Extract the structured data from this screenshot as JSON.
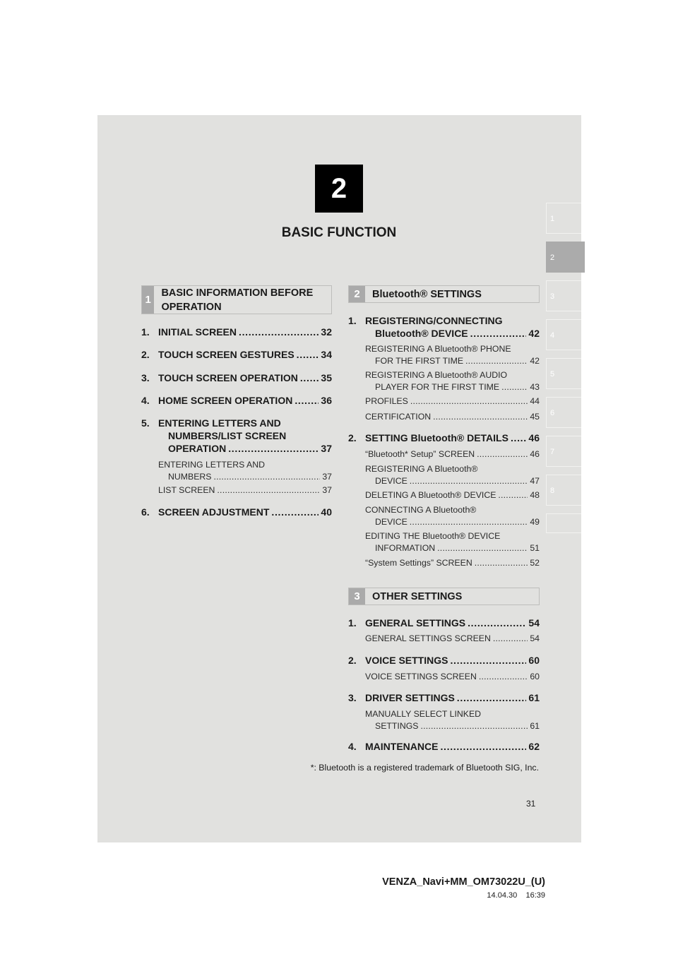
{
  "chapter": {
    "number": "2",
    "title": "BASIC FUNCTION"
  },
  "side_tabs": [
    {
      "label": "1"
    },
    {
      "label": "2",
      "active": true
    },
    {
      "label": "3"
    },
    {
      "label": "4"
    },
    {
      "label": "5"
    },
    {
      "label": "6"
    },
    {
      "label": "7"
    },
    {
      "label": "8"
    },
    {
      "label": ""
    }
  ],
  "sections": [
    {
      "num": "1",
      "title": "BASIC INFORMATION BEFORE OPERATION",
      "entries": [
        {
          "level": "main",
          "num": "1.",
          "lines": [
            "INITIAL SCREEN"
          ],
          "page": "32"
        },
        {
          "level": "main",
          "num": "2.",
          "lines": [
            "TOUCH SCREEN GESTURES"
          ],
          "page": "34"
        },
        {
          "level": "main",
          "num": "3.",
          "lines": [
            "TOUCH SCREEN OPERATION"
          ],
          "page": "35"
        },
        {
          "level": "main",
          "num": "4.",
          "lines": [
            "HOME SCREEN OPERATION"
          ],
          "page": "36"
        },
        {
          "level": "main",
          "num": "5.",
          "lines": [
            "ENTERING LETTERS AND",
            "NUMBERS/LIST SCREEN",
            "OPERATION"
          ],
          "page": "37"
        },
        {
          "level": "sub",
          "lines": [
            "ENTERING LETTERS AND",
            "NUMBERS"
          ],
          "page": "37"
        },
        {
          "level": "sub",
          "lines": [
            "LIST SCREEN"
          ],
          "page": "37"
        },
        {
          "level": "main",
          "num": "6.",
          "lines": [
            "SCREEN ADJUSTMENT"
          ],
          "page": "40"
        }
      ]
    },
    {
      "num": "2",
      "title": "Bluetooth® SETTINGS",
      "entries": [
        {
          "level": "main",
          "num": "1.",
          "lines": [
            "REGISTERING/CONNECTING",
            "Bluetooth® DEVICE"
          ],
          "page": "42"
        },
        {
          "level": "sub",
          "lines": [
            "REGISTERING A Bluetooth® PHONE",
            "FOR THE FIRST TIME"
          ],
          "page": "42"
        },
        {
          "level": "sub",
          "lines": [
            "REGISTERING A Bluetooth® AUDIO",
            "PLAYER FOR THE FIRST TIME"
          ],
          "page": "43"
        },
        {
          "level": "sub",
          "lines": [
            "PROFILES"
          ],
          "page": "44"
        },
        {
          "level": "sub",
          "lines": [
            "CERTIFICATION"
          ],
          "page": "45"
        },
        {
          "level": "main",
          "num": "2.",
          "lines": [
            "SETTING Bluetooth® DETAILS"
          ],
          "page": "46"
        },
        {
          "level": "sub",
          "lines": [
            "“Bluetooth* Setup” SCREEN"
          ],
          "page": "46"
        },
        {
          "level": "sub",
          "lines": [
            "REGISTERING A Bluetooth®",
            "DEVICE"
          ],
          "page": "47"
        },
        {
          "level": "sub",
          "lines": [
            "DELETING A Bluetooth® DEVICE"
          ],
          "page": "48"
        },
        {
          "level": "sub",
          "lines": [
            "CONNECTING A Bluetooth®",
            "DEVICE"
          ],
          "page": "49"
        },
        {
          "level": "sub",
          "lines": [
            "EDITING THE Bluetooth® DEVICE",
            "INFORMATION"
          ],
          "page": "51"
        },
        {
          "level": "sub",
          "lines": [
            "“System Settings” SCREEN"
          ],
          "page": "52"
        }
      ]
    },
    {
      "num": "3",
      "title": "OTHER SETTINGS",
      "entries": [
        {
          "level": "main",
          "num": "1.",
          "lines": [
            "GENERAL SETTINGS"
          ],
          "page": "54"
        },
        {
          "level": "sub",
          "lines": [
            "GENERAL SETTINGS SCREEN"
          ],
          "page": "54"
        },
        {
          "level": "main",
          "num": "2.",
          "lines": [
            "VOICE SETTINGS"
          ],
          "page": "60"
        },
        {
          "level": "sub",
          "lines": [
            "VOICE SETTINGS SCREEN"
          ],
          "page": "60"
        },
        {
          "level": "main",
          "num": "3.",
          "lines": [
            "DRIVER SETTINGS"
          ],
          "page": "61"
        },
        {
          "level": "sub",
          "lines": [
            "MANUALLY SELECT LINKED",
            "SETTINGS"
          ],
          "page": "61"
        },
        {
          "level": "main",
          "num": "4.",
          "lines": [
            "MAINTENANCE"
          ],
          "page": "62"
        }
      ]
    }
  ],
  "footnote": "*: Bluetooth is a registered trademark of Bluetooth SIG, Inc.",
  "page_number": "31",
  "footer": {
    "doc_id": "VENZA_Navi+MM_OM73022U_(U)",
    "date": "14.04.30",
    "time": "16:39"
  },
  "colors": {
    "panel": "#e1e1df",
    "chapter_box": "#000000",
    "active_tab": "#ababab"
  }
}
